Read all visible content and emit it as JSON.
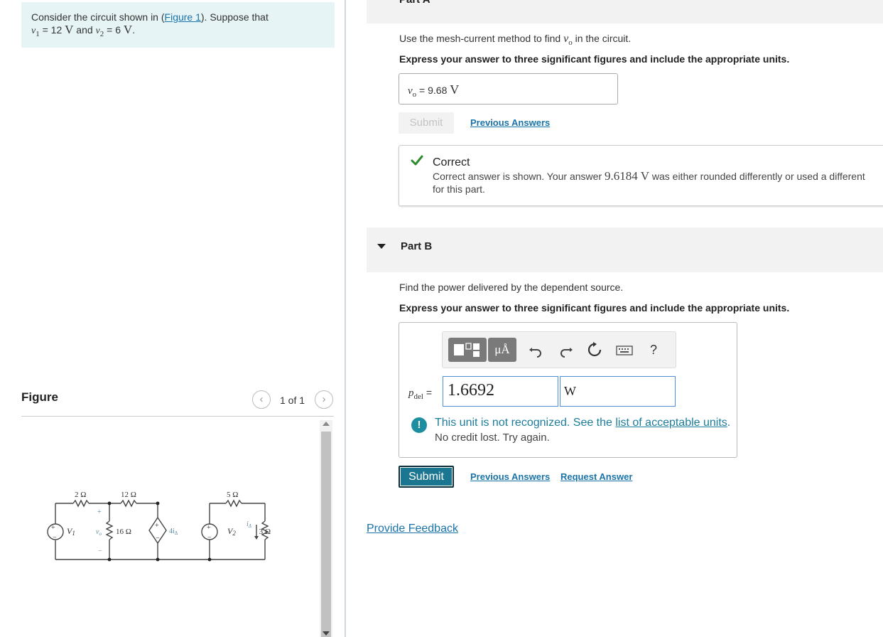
{
  "problem": {
    "intro": "Consider the circuit shown in (",
    "figure_link": "Figure 1",
    "intro_end": "). Suppose that",
    "v1": "v",
    "v1_sub": "1",
    "v1_value": " = 12 ",
    "v1_unit": "V",
    "and": " and ",
    "v2": "v",
    "v2_sub": "2",
    "v2_value": " = 6 ",
    "v2_unit": "V",
    "period": "."
  },
  "figure": {
    "label": "Figure",
    "pager": "1 of 1",
    "prev_icon": "chevron-left-icon",
    "next_icon": "chevron-right-icon",
    "circuit": {
      "r1": "2 Ω",
      "r2": "12 Ω",
      "r3": "5 Ω",
      "r4": "16 Ω",
      "r5": "3 Ω",
      "src1": "V",
      "src1_sub": "1",
      "src2": "V",
      "src2_sub": "2",
      "dep": "4i",
      "dep_sub": "Δ",
      "vo": "v",
      "vo_sub": "o",
      "idelta": "i",
      "idelta_sub": "Δ",
      "plus": "+",
      "minus": "−"
    }
  },
  "part_a": {
    "title": "Part A",
    "question_pre": "Use the mesh-current method to find ",
    "question_var": "v",
    "question_sub": "o",
    "question_post": " in the circuit.",
    "instruction": "Express your answer to three significant figures and include the appropriate units.",
    "answer_var": "v",
    "answer_sub": "o",
    "answer_eq": " =  9.68 ",
    "answer_unit": "V",
    "submit_label": "Submit",
    "previous_answers": "Previous Answers",
    "feedback": {
      "icon": "checkmark-icon",
      "title": "Correct",
      "msg_pre": "Correct answer is shown. Your answer ",
      "msg_value": "9.6184 V",
      "msg_post": " was either rounded differently or used a different",
      "msg_line2": "for this part."
    }
  },
  "part_b": {
    "title": "Part B",
    "question": "Find the power delivered by the dependent source.",
    "instruction": "Express your answer to three significant figures and include the appropriate units.",
    "toolbar": {
      "templates_icon": "templates-icon",
      "units_label": "μÅ",
      "undo_icon": "undo-icon",
      "redo_icon": "redo-icon",
      "reset_icon": "reset-icon",
      "keyboard_icon": "keyboard-icon",
      "help_label": "?"
    },
    "label_var": "p",
    "label_sub": "del",
    "label_eq": " =",
    "value": "1.6692",
    "unit": "W",
    "warning": {
      "icon": "exclamation-icon",
      "pre": "This unit is not recognized. See the ",
      "link": "list of acceptable units",
      "post": ".",
      "line2": "No credit lost. Try again."
    },
    "submit_label": "Submit",
    "previous_answers": "Previous Answers",
    "request_answer": "Request Answer"
  },
  "provide_feedback": "Provide Feedback",
  "colors": {
    "accent": "#1a73a8",
    "submit": "#1b7692",
    "correct": "#2e8b2e",
    "problem_bg": "#e6f4f5"
  }
}
